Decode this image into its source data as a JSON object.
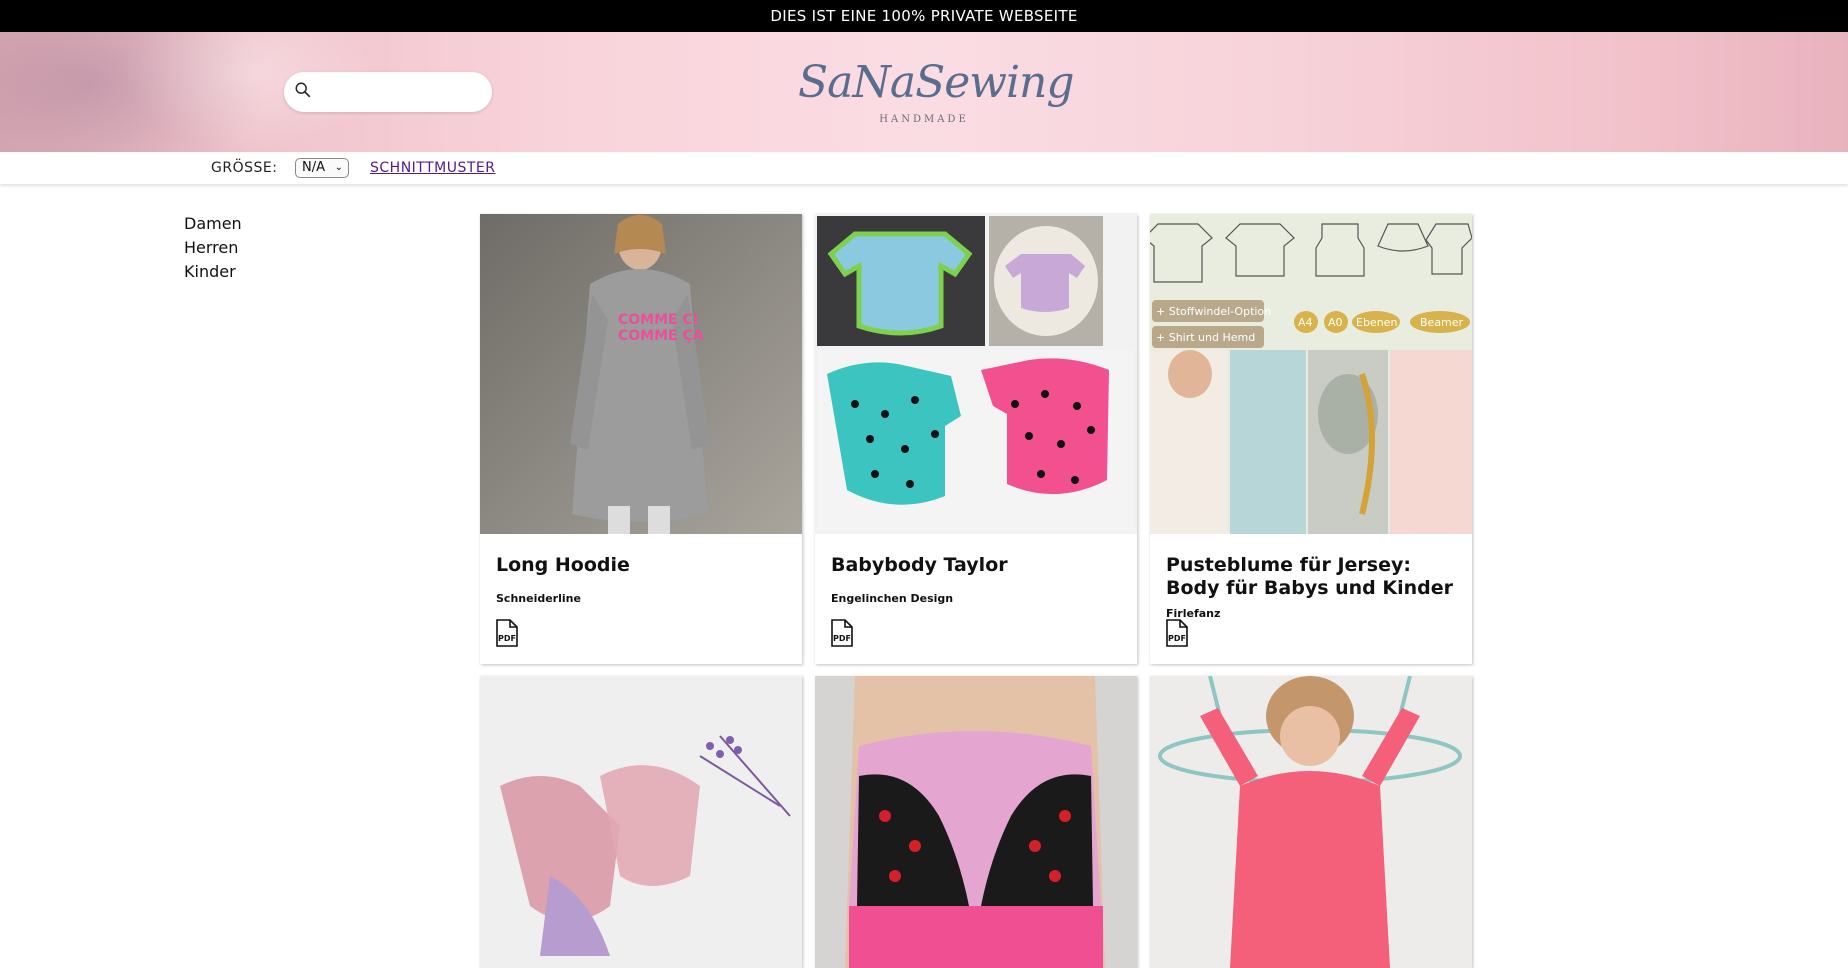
{
  "banner": {
    "text": "DIES IST EINE 100% PRIVATE WEBSEITE"
  },
  "header": {
    "search": {
      "placeholder": "",
      "icon": "search-icon"
    },
    "logo": {
      "text": "SaNaSewing",
      "tagline": "HANDMADE"
    }
  },
  "filters": {
    "size_label": "GRÖSSE:",
    "size_selected": "N/A",
    "category_link": "SCHNITTMUSTER"
  },
  "sidebar": {
    "items": [
      {
        "label": "Damen"
      },
      {
        "label": "Herren"
      },
      {
        "label": "Kinder"
      }
    ]
  },
  "products": [
    {
      "title": "Long Hoodie",
      "brand": "Schneiderline",
      "format_icon": "pdf-icon",
      "image": "girl-in-grey-hoodie-dress"
    },
    {
      "title": "Babybody Taylor",
      "brand": "Engelinchen Design",
      "format_icon": "pdf-icon",
      "image": "baby-bodysuits-collage"
    },
    {
      "title": "Pusteblume für Jersey: Body für Babys und Kinder",
      "brand": "Firlefanz",
      "format_icon": "pdf-icon",
      "image": "pattern-sketches-and-children"
    },
    {
      "title": "",
      "brand": "",
      "image": "pink-lace-underwear-lavender"
    },
    {
      "title": "",
      "brand": "",
      "image": "pink-cherry-panties"
    },
    {
      "title": "",
      "brand": "",
      "image": "girl-pink-top-playing"
    }
  ],
  "colors": {
    "banner_bg": "#000000",
    "hero_pink": "#f9d3da",
    "link_visited": "#551a8b"
  }
}
